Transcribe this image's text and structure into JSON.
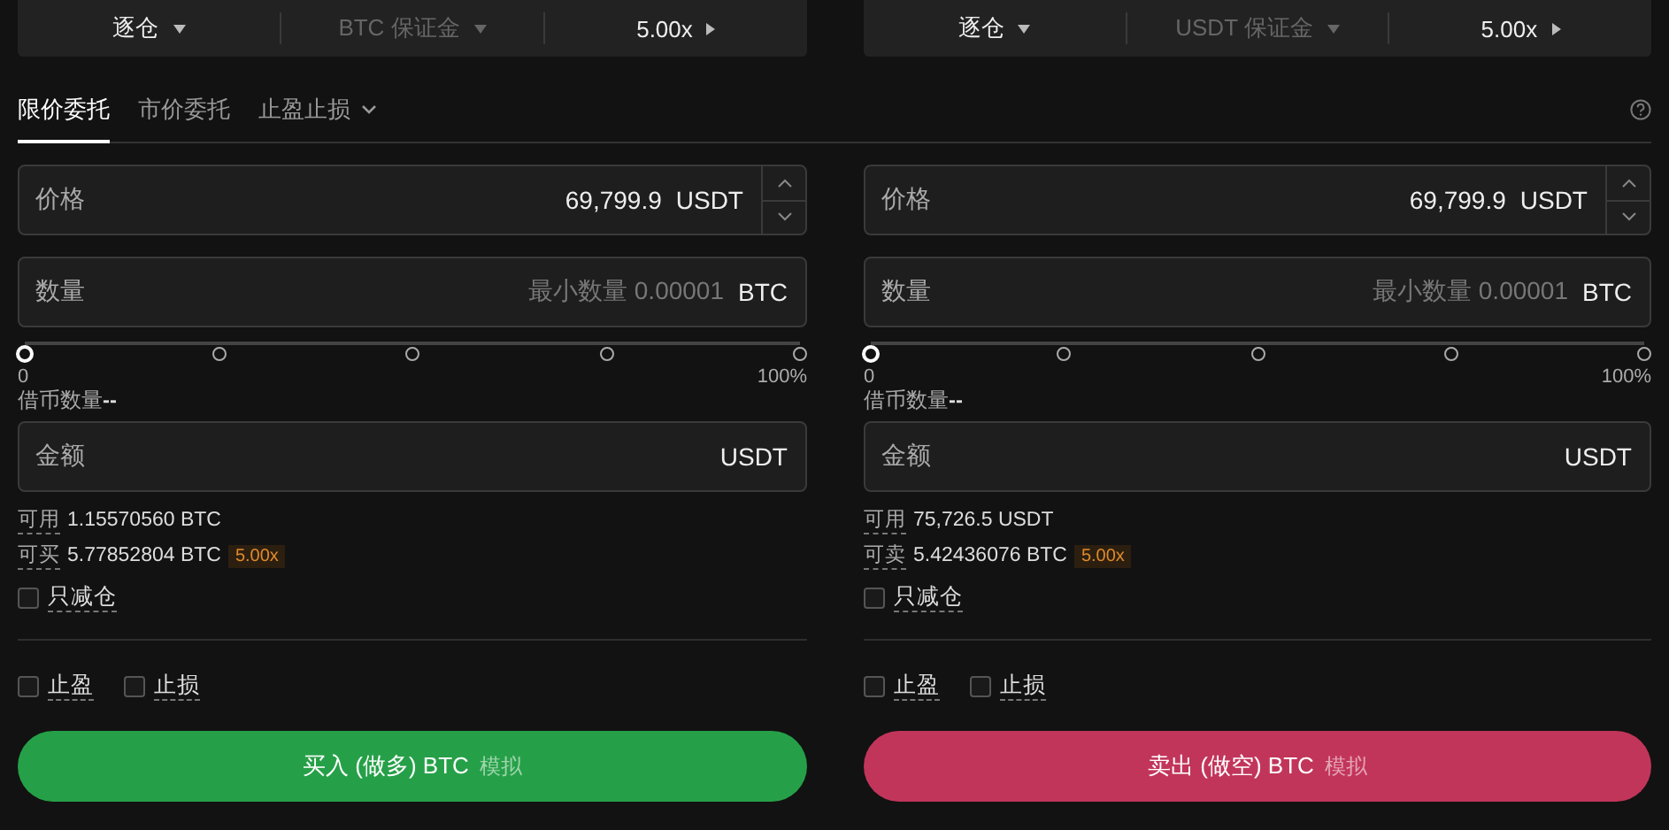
{
  "mode_bars": [
    {
      "segments": [
        {
          "label": "逐仓",
          "kind": "dropdown",
          "dimmed": false
        },
        {
          "label": "BTC 保证金",
          "kind": "dropdown",
          "dimmed": true
        },
        {
          "label": "5.00x",
          "kind": "arrow",
          "dimmed": false
        }
      ]
    },
    {
      "segments": [
        {
          "label": "逐仓",
          "kind": "dropdown",
          "dimmed": false
        },
        {
          "label": "USDT 保证金",
          "kind": "dropdown",
          "dimmed": true
        },
        {
          "label": "5.00x",
          "kind": "arrow",
          "dimmed": false
        }
      ]
    }
  ],
  "tabs": [
    {
      "label": "限价委托",
      "selected": true,
      "kind": "plain"
    },
    {
      "label": "市价委托",
      "selected": false,
      "kind": "plain"
    },
    {
      "label": "止盈止损",
      "selected": false,
      "kind": "dropdown"
    }
  ],
  "panels": [
    {
      "price": {
        "label": "价格",
        "value": "69,799.9",
        "unit": "USDT"
      },
      "quantity": {
        "label": "数量",
        "placeholder": "最小数量 0.00001",
        "unit": "BTC"
      },
      "slider": {
        "level": 0,
        "min_label": "0",
        "max_label": "100%"
      },
      "borrow": {
        "label": "借币数量",
        "value": "--"
      },
      "amount": {
        "label": "金额",
        "unit": "USDT"
      },
      "available": {
        "label": "可用",
        "value": "1.15570560 BTC"
      },
      "max": {
        "label": "可买",
        "value": "5.77852804 BTC",
        "leverage": "5.00x"
      },
      "reduce_only": {
        "label": "只减仓",
        "checked": false
      },
      "take_profit": {
        "label": "止盈",
        "checked": false
      },
      "stop_loss": {
        "label": "止损",
        "checked": false
      },
      "submit": {
        "kind": "buy",
        "label": "买入 (做多) BTC",
        "note": "模拟"
      }
    },
    {
      "price": {
        "label": "价格",
        "value": "69,799.9",
        "unit": "USDT"
      },
      "quantity": {
        "label": "数量",
        "placeholder": "最小数量 0.00001",
        "unit": "BTC"
      },
      "slider": {
        "level": 0,
        "min_label": "0",
        "max_label": "100%"
      },
      "borrow": {
        "label": "借币数量",
        "value": "--"
      },
      "amount": {
        "label": "金额",
        "unit": "USDT"
      },
      "available": {
        "label": "可用",
        "value": "75,726.5 USDT"
      },
      "max": {
        "label": "可卖",
        "value": "5.42436076 BTC",
        "leverage": "5.00x"
      },
      "reduce_only": {
        "label": "只减仓",
        "checked": false
      },
      "take_profit": {
        "label": "止盈",
        "checked": false
      },
      "stop_loss": {
        "label": "止损",
        "checked": false
      },
      "submit": {
        "kind": "sell",
        "label": "卖出 (做空) BTC",
        "note": "模拟"
      }
    }
  ]
}
